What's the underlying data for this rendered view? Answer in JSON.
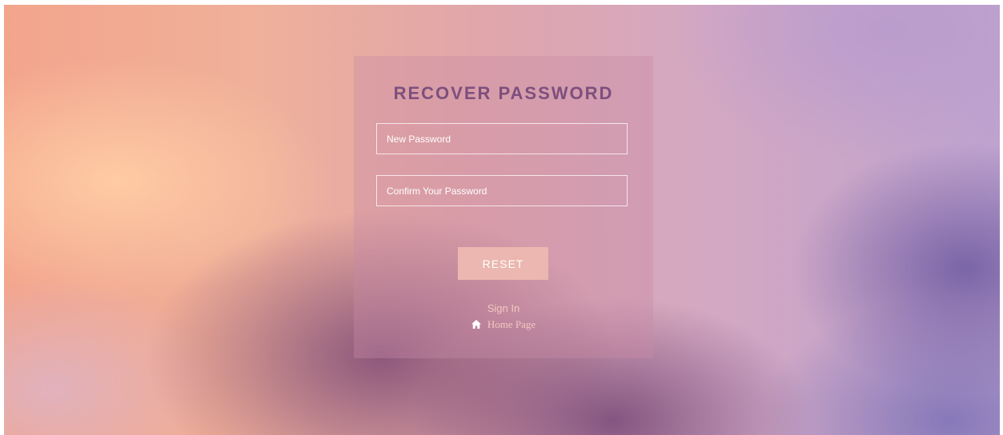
{
  "form": {
    "title": "RECOVER PASSWORD",
    "new_password_placeholder": "New Password",
    "confirm_password_placeholder": "Confirm Your Password",
    "reset_label": "RESET"
  },
  "links": {
    "sign_in": "Sign In",
    "home_page": "Home Page",
    "home_icon": "home-icon"
  },
  "colors": {
    "title": "#7d4f7d",
    "button": "#ebb7b0",
    "link": "#f4c7c2"
  }
}
